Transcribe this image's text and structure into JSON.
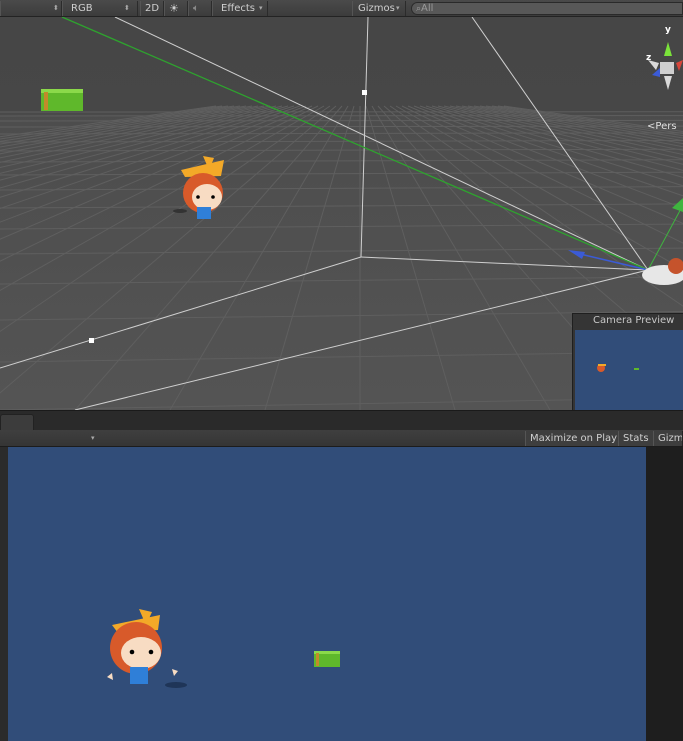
{
  "scene_toolbar": {
    "shading_mode": "RGB",
    "mode_2d": "2D",
    "sun_icon": "sun-icon",
    "audio_icon": "speaker-icon",
    "effects_label": "Effects",
    "gizmos_label": "Gizmos",
    "search_placeholder": "All"
  },
  "scene_gizmo": {
    "axis_y": "y",
    "axis_z": "z",
    "projection_label": "Pers"
  },
  "camera_preview": {
    "title": "Camera Preview"
  },
  "game_toolbar": {
    "maximize_label": "Maximize on Play",
    "stats_label": "Stats",
    "gizmos_label": "Gizm"
  },
  "colors": {
    "game_background": "#314d79",
    "grid_line": "#5e5e5e",
    "camera_frustum": "#d0d0d0",
    "camera_axis_green": "#2ea32e"
  }
}
